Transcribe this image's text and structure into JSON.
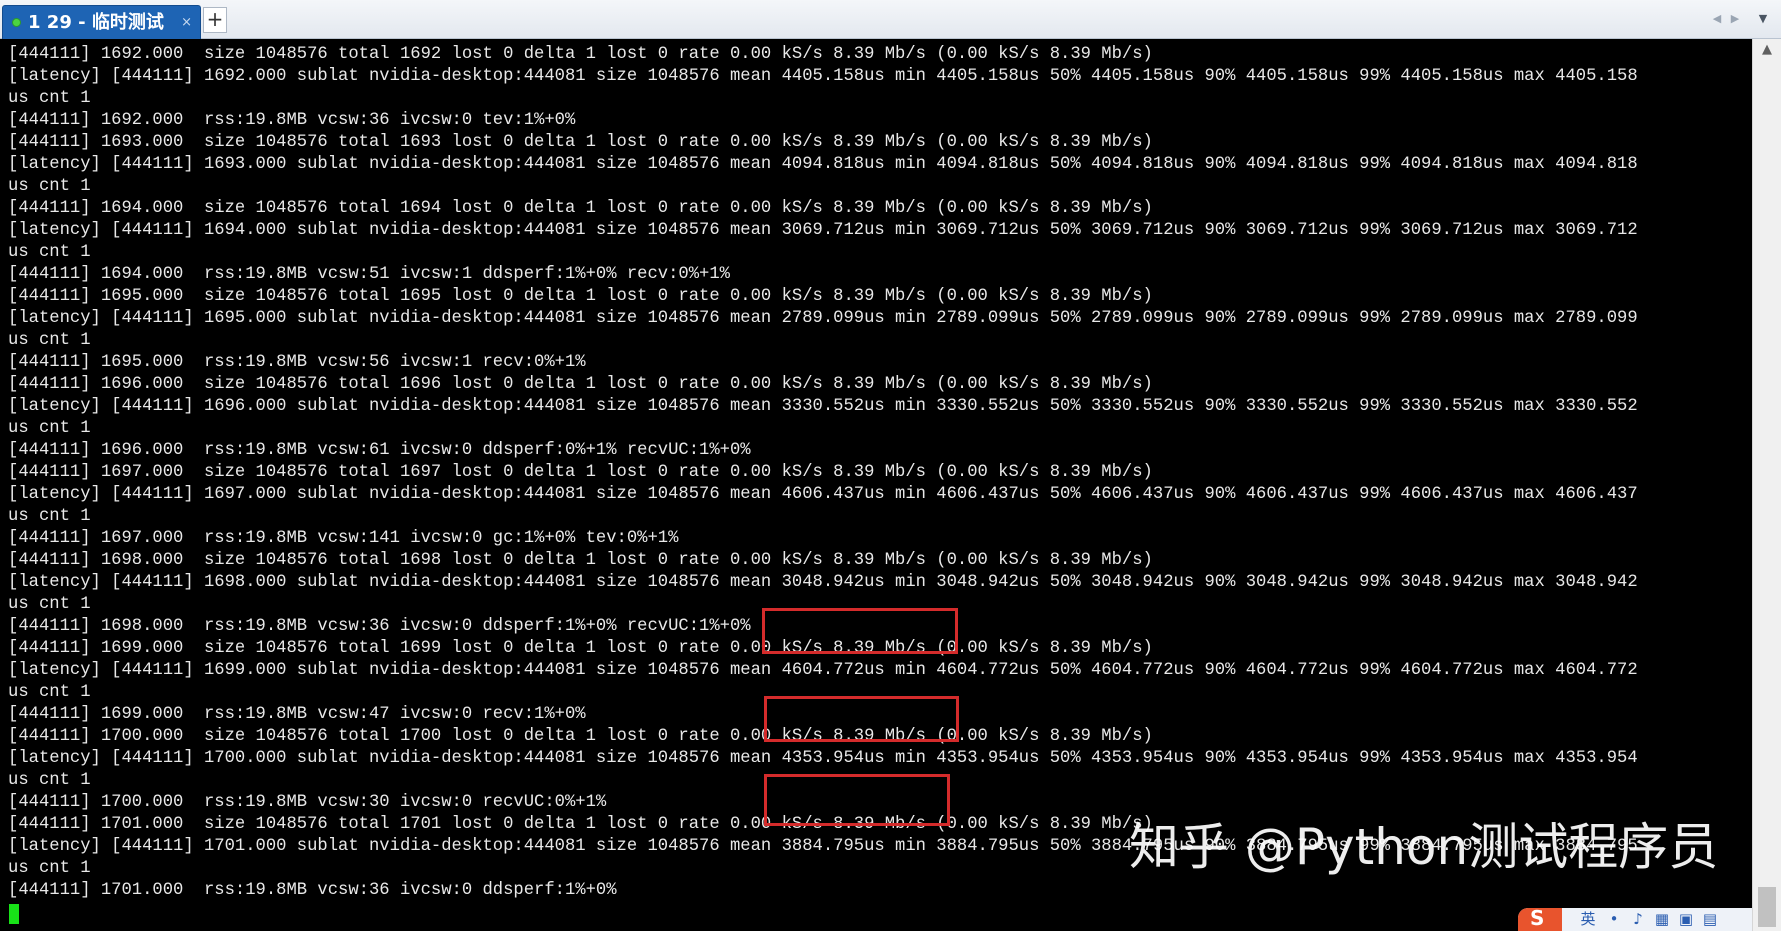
{
  "tab": {
    "title": "1 29 - 临时测试",
    "close_glyph": "×",
    "new_tab_glyph": "+",
    "status_color": "#4cd442"
  },
  "nav": {
    "left_glyph": "◀",
    "right_glyph": "▶",
    "menu_glyph": "▼"
  },
  "terminal": {
    "lines": [
      "[444111] 1692.000  size 1048576 total 1692 lost 0 delta 1 lost 0 rate 0.00 kS/s 8.39 Mb/s (0.00 kS/s 8.39 Mb/s)",
      "[latency] [444111] 1692.000 sublat nvidia-desktop:444081 size 1048576 mean 4405.158us min 4405.158us 50% 4405.158us 90% 4405.158us 99% 4405.158us max 4405.158",
      "us cnt 1",
      "[444111] 1692.000  rss:19.8MB vcsw:36 ivcsw:0 tev:1%+0%",
      "[444111] 1693.000  size 1048576 total 1693 lost 0 delta 1 lost 0 rate 0.00 kS/s 8.39 Mb/s (0.00 kS/s 8.39 Mb/s)",
      "[latency] [444111] 1693.000 sublat nvidia-desktop:444081 size 1048576 mean 4094.818us min 4094.818us 50% 4094.818us 90% 4094.818us 99% 4094.818us max 4094.818",
      "us cnt 1",
      "[444111] 1694.000  size 1048576 total 1694 lost 0 delta 1 lost 0 rate 0.00 kS/s 8.39 Mb/s (0.00 kS/s 8.39 Mb/s)",
      "[latency] [444111] 1694.000 sublat nvidia-desktop:444081 size 1048576 mean 3069.712us min 3069.712us 50% 3069.712us 90% 3069.712us 99% 3069.712us max 3069.712",
      "us cnt 1",
      "[444111] 1694.000  rss:19.8MB vcsw:51 ivcsw:1 ddsperf:1%+0% recv:0%+1%",
      "[444111] 1695.000  size 1048576 total 1695 lost 0 delta 1 lost 0 rate 0.00 kS/s 8.39 Mb/s (0.00 kS/s 8.39 Mb/s)",
      "[latency] [444111] 1695.000 sublat nvidia-desktop:444081 size 1048576 mean 2789.099us min 2789.099us 50% 2789.099us 90% 2789.099us 99% 2789.099us max 2789.099",
      "us cnt 1",
      "[444111] 1695.000  rss:19.8MB vcsw:56 ivcsw:1 recv:0%+1%",
      "[444111] 1696.000  size 1048576 total 1696 lost 0 delta 1 lost 0 rate 0.00 kS/s 8.39 Mb/s (0.00 kS/s 8.39 Mb/s)",
      "[latency] [444111] 1696.000 sublat nvidia-desktop:444081 size 1048576 mean 3330.552us min 3330.552us 50% 3330.552us 90% 3330.552us 99% 3330.552us max 3330.552",
      "us cnt 1",
      "[444111] 1696.000  rss:19.8MB vcsw:61 ivcsw:0 ddsperf:0%+1% recvUC:1%+0%",
      "[444111] 1697.000  size 1048576 total 1697 lost 0 delta 1 lost 0 rate 0.00 kS/s 8.39 Mb/s (0.00 kS/s 8.39 Mb/s)",
      "[latency] [444111] 1697.000 sublat nvidia-desktop:444081 size 1048576 mean 4606.437us min 4606.437us 50% 4606.437us 90% 4606.437us 99% 4606.437us max 4606.437",
      "us cnt 1",
      "[444111] 1697.000  rss:19.8MB vcsw:141 ivcsw:0 gc:1%+0% tev:0%+1%",
      "[444111] 1698.000  size 1048576 total 1698 lost 0 delta 1 lost 0 rate 0.00 kS/s 8.39 Mb/s (0.00 kS/s 8.39 Mb/s)",
      "[latency] [444111] 1698.000 sublat nvidia-desktop:444081 size 1048576 mean 3048.942us min 3048.942us 50% 3048.942us 90% 3048.942us 99% 3048.942us max 3048.942",
      "us cnt 1",
      "[444111] 1698.000  rss:19.8MB vcsw:36 ivcsw:0 ddsperf:1%+0% recvUC:1%+0%",
      "[444111] 1699.000  size 1048576 total 1699 lost 0 delta 1 lost 0 rate 0.00 kS/s 8.39 Mb/s (0.00 kS/s 8.39 Mb/s)",
      "[latency] [444111] 1699.000 sublat nvidia-desktop:444081 size 1048576 mean 4604.772us min 4604.772us 50% 4604.772us 90% 4604.772us 99% 4604.772us max 4604.772",
      "us cnt 1",
      "[444111] 1699.000  rss:19.8MB vcsw:47 ivcsw:0 recv:1%+0%",
      "[444111] 1700.000  size 1048576 total 1700 lost 0 delta 1 lost 0 rate 0.00 kS/s 8.39 Mb/s (0.00 kS/s 8.39 Mb/s)",
      "[latency] [444111] 1700.000 sublat nvidia-desktop:444081 size 1048576 mean 4353.954us min 4353.954us 50% 4353.954us 90% 4353.954us 99% 4353.954us max 4353.954",
      "us cnt 1",
      "[444111] 1700.000  rss:19.8MB vcsw:30 ivcsw:0 recvUC:0%+1%",
      "[444111] 1701.000  size 1048576 total 1701 lost 0 delta 1 lost 0 rate 0.00 kS/s 8.39 Mb/s (0.00 kS/s 8.39 Mb/s)",
      "[latency] [444111] 1701.000 sublat nvidia-desktop:444081 size 1048576 mean 3884.795us min 3884.795us 50% 3884.795us 90% 3884.795us 99% 3884.795us max 3884.795",
      "us cnt 1",
      "[444111] 1701.000  rss:19.8MB vcsw:36 ivcsw:0 ddsperf:1%+0%"
    ],
    "text_color": "#e8e8e8",
    "background": "#000000",
    "cursor_color": "#18e218",
    "highlight_color": "#d42b2b"
  },
  "watermark": {
    "text": "知乎 @Python测试程序员"
  },
  "scrollbar": {
    "up_glyph": "▲"
  },
  "ime": {
    "logo_letter": "S",
    "brand_color": "#e8542d"
  }
}
